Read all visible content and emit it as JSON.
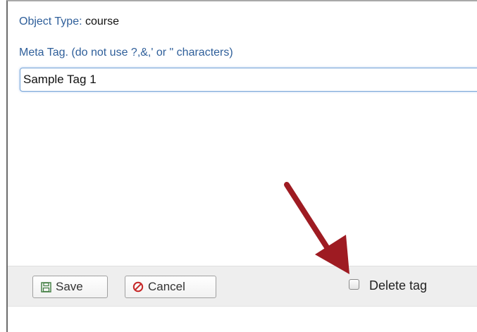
{
  "form": {
    "object_type_label": "Object Type:",
    "object_type_value": "course",
    "meta_tag_label": "Meta Tag. (do not use ?,&,' or \" characters)",
    "meta_tag_value": "Sample Tag 1"
  },
  "actions": {
    "save_label": "Save",
    "cancel_label": "Cancel",
    "delete_tag_label": "Delete tag",
    "delete_tag_checked": false
  },
  "annotation": {
    "arrow_color": "#9e1b22",
    "arrow_target": "delete-tag-checkbox"
  },
  "icons": {
    "save": "floppy-disk-icon",
    "cancel": "prohibited-icon"
  }
}
